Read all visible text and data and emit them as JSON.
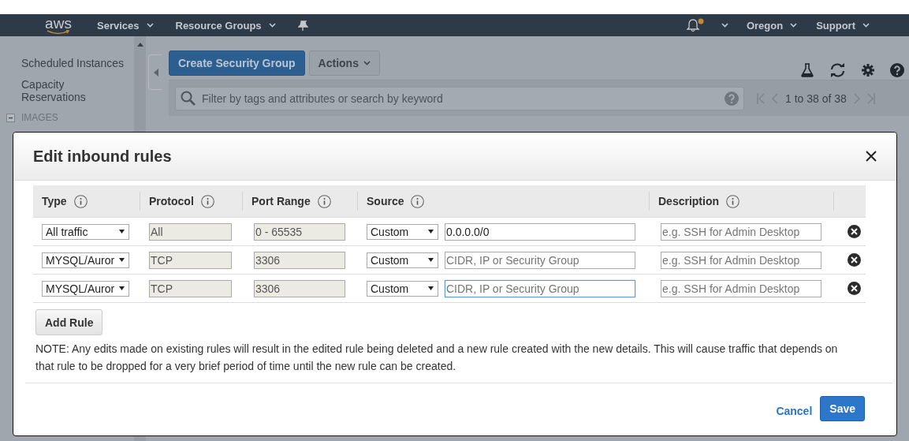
{
  "nav": {
    "logo": "aws",
    "menus": [
      {
        "label": "Services"
      },
      {
        "label": "Resource Groups"
      }
    ],
    "region": "Oregon",
    "support": "Support"
  },
  "sidebar": {
    "items": [
      {
        "label": "Scheduled Instances",
        "kind": "link"
      },
      {
        "label": "Capacity Reservations",
        "kind": "link"
      },
      {
        "label": "IMAGES",
        "kind": "section"
      }
    ]
  },
  "toolbar": {
    "buttons": [
      {
        "label": "Create Security Group",
        "kind": "primary"
      },
      {
        "label": "Actions",
        "kind": "dropdown"
      }
    ]
  },
  "search": {
    "placeholder": "Filter by tags and attributes or search by keyword"
  },
  "pagination": {
    "text": "1 to 38 of 38"
  },
  "modal": {
    "title": "Edit inbound rules",
    "columns": [
      "Type",
      "Protocol",
      "Port Range",
      "Source",
      "Description"
    ],
    "rules": [
      {
        "type": "All traffic",
        "protocol": "All",
        "port_range": "0 - 65535",
        "source": "Custom",
        "cidr_value": "0.0.0.0/0",
        "description_placeholder": "e.g. SSH for Admin Desktop",
        "focused": false
      },
      {
        "type": "MYSQL/Auror",
        "protocol": "TCP",
        "port_range": "3306",
        "source": "Custom",
        "cidr_placeholder": "CIDR, IP or Security Group",
        "description_placeholder": "e.g. SSH for Admin Desktop",
        "focused": false
      },
      {
        "type": "MYSQL/Auror",
        "protocol": "TCP",
        "port_range": "3306",
        "source": "Custom",
        "cidr_placeholder": "CIDR, IP or Security Group",
        "description_placeholder": "e.g. SSH for Admin Desktop",
        "focused": true
      }
    ],
    "add_rule": "Add Rule",
    "note": "NOTE: Any edits made on existing rules will result in the edited rule being deleted and a new rule created with the new details. This will cause traffic that depends on that rule to be dropped for a very brief period of time until the new rule can be created.",
    "cancel": "Cancel",
    "save": "Save"
  }
}
